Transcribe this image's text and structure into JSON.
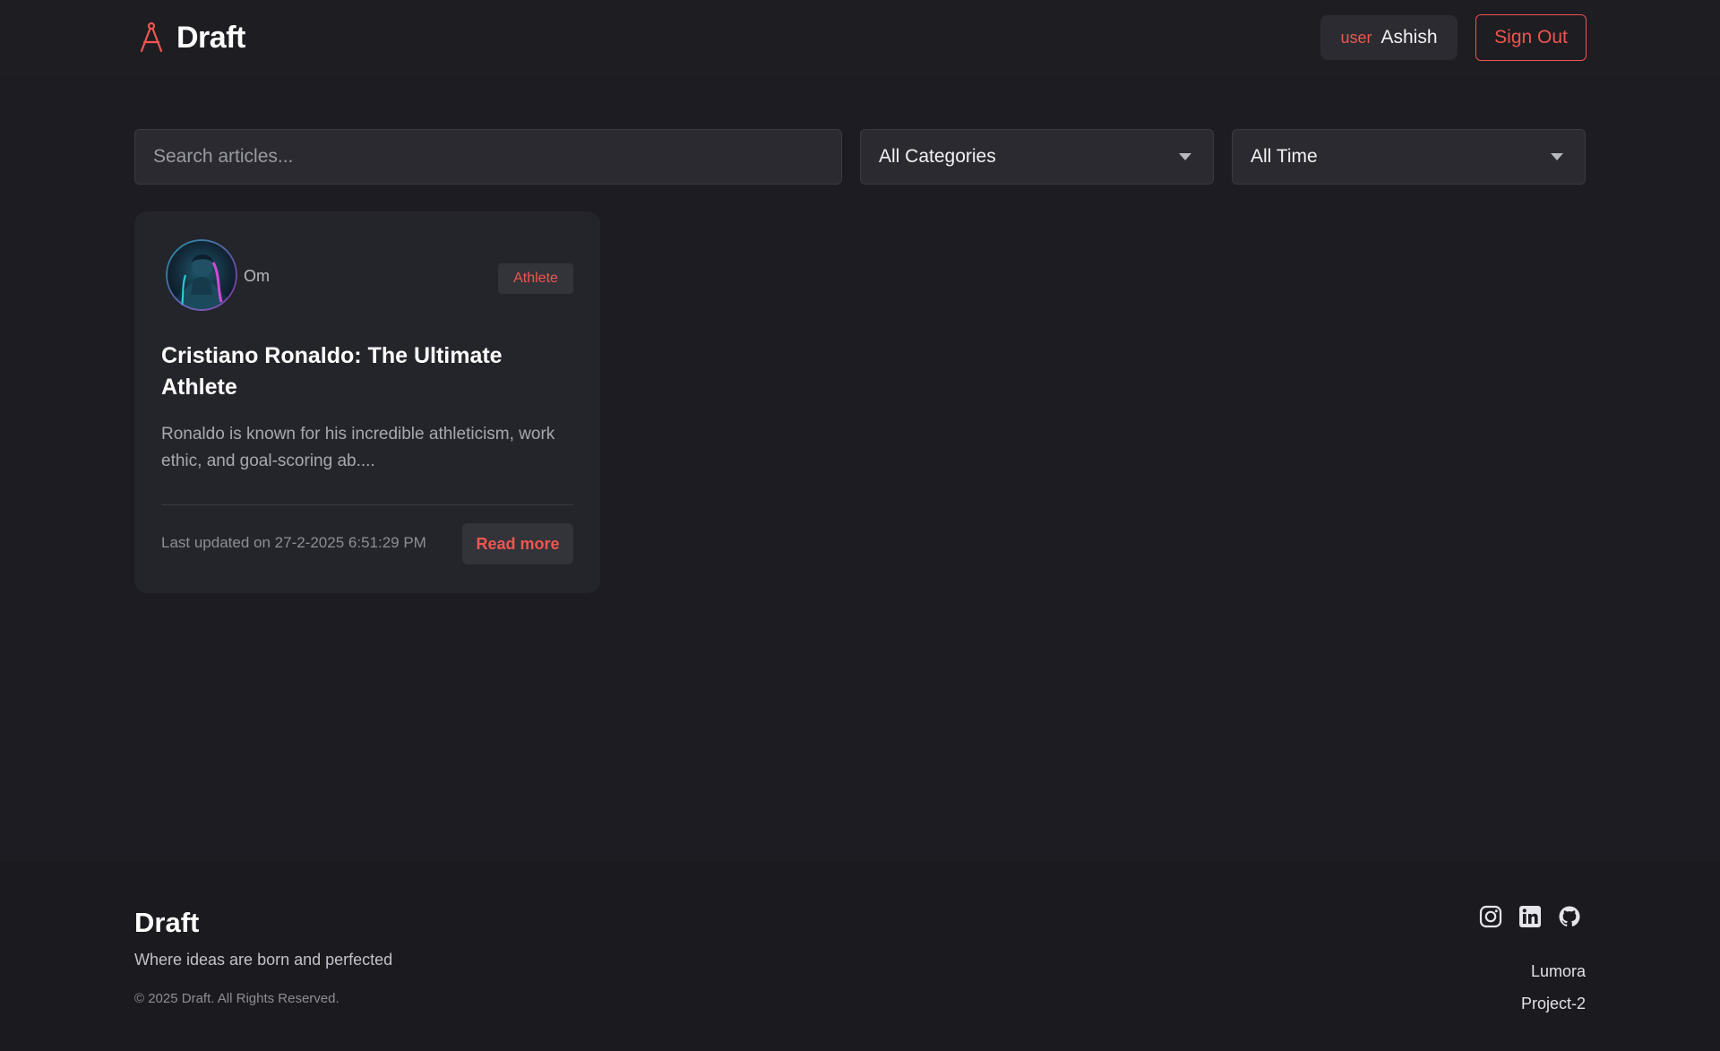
{
  "header": {
    "brand_name": "Draft",
    "logo_icon": "compass-icon",
    "user_role": "user",
    "user_name": "Ashish",
    "sign_out_label": "Sign Out"
  },
  "filters": {
    "search_placeholder": "Search articles...",
    "search_value": "",
    "category_selected": "All Categories",
    "time_selected": "All Time"
  },
  "articles": [
    {
      "author": "Om",
      "avatar_icon": "author-avatar",
      "category_tag": "Athlete",
      "title": "Cristiano Ronaldo: The Ultimate Athlete",
      "excerpt": "Ronaldo is known for his incredible athleticism, work ethic, and goal-scoring ab....",
      "updated": "Last updated on 27-2-2025 6:51:29 PM",
      "read_more_label": "Read more"
    }
  ],
  "footer": {
    "title": "Draft",
    "tagline": "Where ideas are born and perfected",
    "copyright": "© 2025 Draft. All Rights Reserved.",
    "social_icons": [
      "instagram-icon",
      "linkedin-icon",
      "github-icon"
    ],
    "links": [
      "Lumora",
      "Project-2"
    ]
  },
  "colors": {
    "background": "#1c1c22",
    "card": "#24242b",
    "accent": "#f0564f",
    "input_bg": "#2a2a30"
  }
}
